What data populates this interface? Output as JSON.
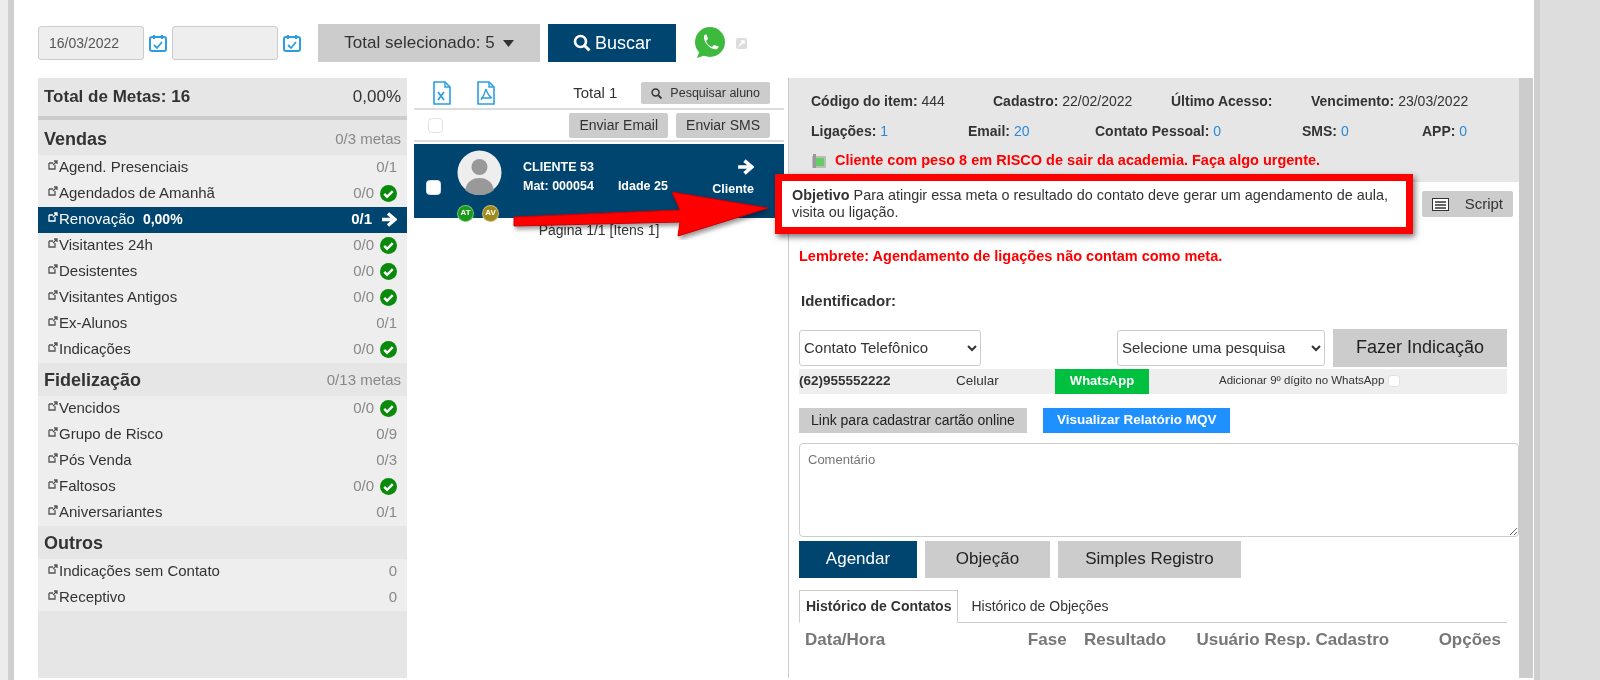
{
  "filters": {
    "date_from": "16/03/2022",
    "selection_button": "Total selecionado: 5",
    "search_button": "Buscar"
  },
  "sidebar": {
    "total_label": "Total de Metas: 16",
    "total_percent": "0,00%",
    "groups": [
      {
        "title": "Vendas",
        "count": "0/3 metas",
        "items": [
          {
            "label": "Agend. Presenciais",
            "count": "0/1",
            "done": false,
            "selected": false
          },
          {
            "label": "Agendados de Amanhã",
            "count": "0/0",
            "done": true,
            "selected": false
          },
          {
            "label": "Renovação",
            "percent": "0,00%",
            "count": "0/1",
            "done": false,
            "selected": true
          },
          {
            "label": "Visitantes 24h",
            "count": "0/0",
            "done": true,
            "selected": false
          },
          {
            "label": "Desistentes",
            "count": "0/0",
            "done": true,
            "selected": false
          },
          {
            "label": "Visitantes Antigos",
            "count": "0/0",
            "done": true,
            "selected": false
          },
          {
            "label": "Ex-Alunos",
            "count": "0/1",
            "done": false,
            "selected": false
          },
          {
            "label": "Indicações",
            "count": "0/0",
            "done": true,
            "selected": false
          }
        ]
      },
      {
        "title": "Fidelização",
        "count": "0/13 metas",
        "items": [
          {
            "label": "Vencidos",
            "count": "0/0",
            "done": true,
            "selected": false
          },
          {
            "label": "Grupo de Risco",
            "count": "0/9",
            "done": false,
            "selected": false
          },
          {
            "label": "Pós Venda",
            "count": "0/3",
            "done": false,
            "selected": false
          },
          {
            "label": "Faltosos",
            "count": "0/0",
            "done": true,
            "selected": false
          },
          {
            "label": "Aniversariantes",
            "count": "0/1",
            "done": false,
            "selected": false
          }
        ]
      },
      {
        "title": "Outros",
        "items": [
          {
            "label": "Indicações sem Contato",
            "count": "0",
            "done": false,
            "selected": false
          },
          {
            "label": "Receptivo",
            "count": "0",
            "done": false,
            "selected": false
          }
        ]
      }
    ]
  },
  "clients": {
    "total": "Total 1",
    "search_button": "Pesquisar aluno",
    "email_button": "Enviar Email",
    "sms_button": "Enviar SMS",
    "select_all_checked": false,
    "items": [
      {
        "name": "CLIENTE 53",
        "mat": "Mat: 000054",
        "age": "Idade 25",
        "status": "Cliente",
        "checked": false,
        "tags": [
          {
            "label": "AT",
            "color": "#1a9a1a"
          },
          {
            "label": "AV",
            "color": "#a08a1e"
          }
        ]
      }
    ],
    "pagination": "Página 1/1 [Itens 1]"
  },
  "detail": {
    "info_rows": [
      [
        {
          "label": "Código do item:",
          "value": "444",
          "kind": "text"
        },
        {
          "label": "Cadastro:",
          "value": "22/02/2022",
          "kind": "text"
        },
        {
          "label": "Último Acesso:"
        },
        {
          "label": "Vencimento:",
          "value": "23/03/2022",
          "kind": "text"
        }
      ],
      [
        {
          "label": "Ligações:",
          "value": "1",
          "kind": "count"
        },
        {
          "label": "Email:",
          "value": "20",
          "kind": "count"
        },
        {
          "label": "Contato Pessoal:",
          "value": "0",
          "kind": "count"
        },
        {
          "label": "SMS:",
          "value": "0",
          "kind": "count"
        },
        {
          "label": "APP:",
          "value": "0",
          "kind": "count"
        }
      ]
    ],
    "alert": "Cliente com peso 8 em RISCO de sair da academia. Faça algo urgente.",
    "objective": "**Objetivo** Para atingir essa meta o resultado do contato deve gerar um agendamento de aula, visita ou ligação.",
    "script_button": "Script",
    "reminder": "Lembrete: Agendamento de ligações não contam como meta.",
    "identifier_label": "Identificador:",
    "contact_select": "Contato Telefônico",
    "survey_select": "Selecione uma pesquisa",
    "indication_button": "Fazer Indicação",
    "phone": {
      "number": "(62)955552222",
      "type": "Celular",
      "whatsapp_button": "WhatsApp",
      "ninth_digit_label": "Adicionar 9º dígito no WhatsApp",
      "ninth_digit_checked": false
    },
    "card_link_button": "Link para cadastrar cartão online",
    "mqv_button": "Visualizar Relatório MQV",
    "comment": {
      "placeholder": "Comentário"
    },
    "actions": [
      {
        "label": "Agendar",
        "primary": true
      },
      {
        "label": "Objeção",
        "primary": false
      },
      {
        "label": "Simples Registro",
        "primary": false
      }
    ],
    "tabs": [
      {
        "label": "Histórico de Contatos",
        "selected": true
      },
      {
        "label": "Histórico de Objeções",
        "selected": false
      }
    ],
    "table": {
      "columns": [
        "Data/Hora",
        "Fase",
        "Resultado",
        "Usuário Resp. Cadastro",
        "Opções"
      ]
    }
  }
}
